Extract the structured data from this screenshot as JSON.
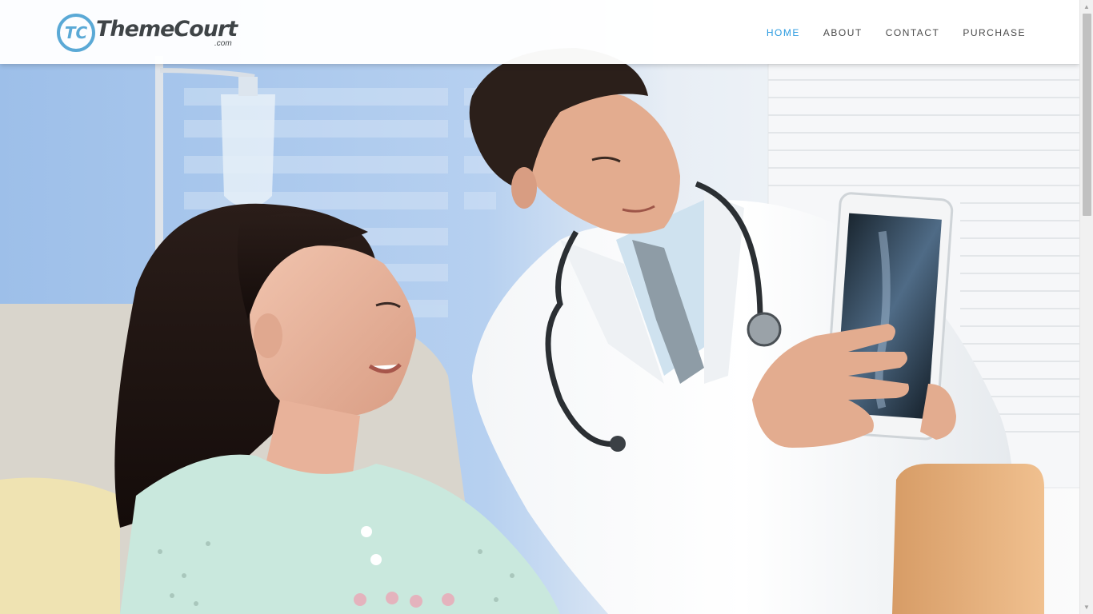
{
  "header": {
    "logo": {
      "brand": "ThemeCourt",
      "domain": ".com",
      "monogram": "TC",
      "accent_color": "#5aa9d6"
    },
    "nav": {
      "home": "HOME",
      "about": "ABOUT",
      "contact": "CONTACT",
      "purchase": "PURCHASE",
      "active_color": "#2b9be0"
    }
  },
  "hero": {
    "image": "photo-doctor-showing-tablet-xray-to-patient"
  },
  "scrollbar": {
    "up_icon": "arrow-up-icon",
    "down_icon": "arrow-down-icon"
  }
}
